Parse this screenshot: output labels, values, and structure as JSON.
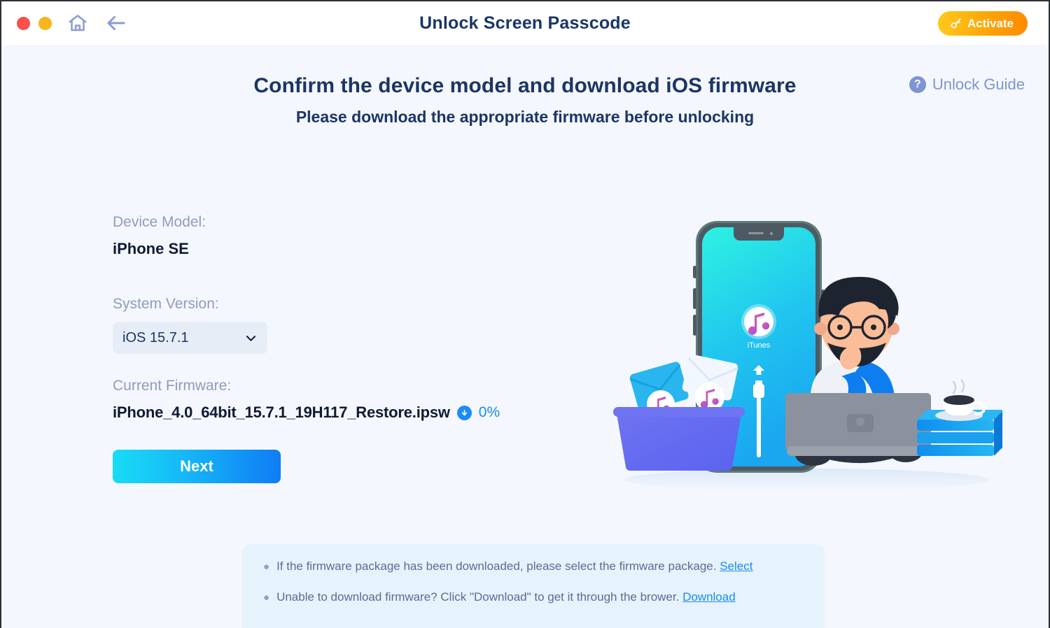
{
  "titlebar": {
    "title": "Unlock Screen Passcode",
    "window_controls": [
      {
        "name": "close",
        "color": "#f8504b"
      },
      {
        "name": "minimize",
        "color": "#f9b51c"
      }
    ],
    "home_icon": "home-icon",
    "back_icon": "back-arrow-icon",
    "activate": {
      "label": "Activate",
      "icon": "key-icon",
      "gradient_from": "#ffc91c",
      "gradient_to": "#ff8a00"
    }
  },
  "header": {
    "heading": "Confirm the device model and download iOS firmware",
    "subheading": "Please download the appropriate firmware before unlocking",
    "unlock_guide": {
      "label": "Unlock Guide",
      "icon": "question-circle-icon",
      "color": "#7e94d4"
    }
  },
  "form": {
    "device_model_label": "Device Model:",
    "device_model_value": "iPhone SE",
    "system_version_label": "System Version:",
    "system_version_value": "iOS 15.7.1",
    "system_version_options": [
      "iOS 15.7.1"
    ],
    "dropdown_icon": "chevron-down-icon",
    "current_firmware_label": "Current Firmware:",
    "firmware_file": "iPhone_4.0_64bit_15.7.1_19H117_Restore.ipsw",
    "download_icon": "download-circle-icon",
    "download_progress": "0%",
    "next_label": "Next",
    "next_gradient_from": "#19dcf5",
    "next_gradient_to": "#0f7cf5"
  },
  "illustration": {
    "name": "itunes-recovery-illustration",
    "phone_app_label": "iTunes",
    "phone_screen_gradient_from": "#2ef2e2",
    "phone_screen_gradient_to": "#1aa7f0"
  },
  "notice": {
    "background": "#e6f2fc",
    "lines": [
      {
        "text": "If the firmware package has been downloaded, please select the firmware package.",
        "link": "Select"
      },
      {
        "text": "Unable to download firmware? Click \"Download\" to get it through the brower.",
        "link": "Download"
      }
    ]
  }
}
